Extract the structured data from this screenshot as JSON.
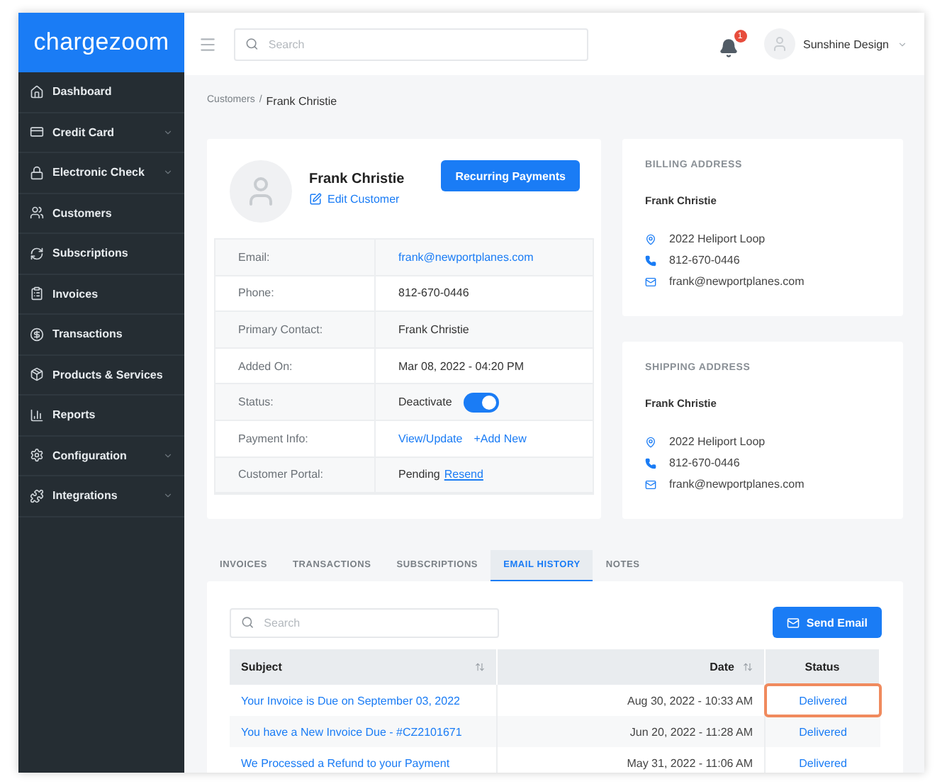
{
  "brand": {
    "logo": "chargezoom"
  },
  "sidebar": {
    "items": [
      {
        "label": "Dashboard",
        "expandable": false
      },
      {
        "label": "Credit Card",
        "expandable": true
      },
      {
        "label": "Electronic Check",
        "expandable": true
      },
      {
        "label": "Customers",
        "expandable": false
      },
      {
        "label": "Subscriptions",
        "expandable": false
      },
      {
        "label": "Invoices",
        "expandable": false
      },
      {
        "label": "Transactions",
        "expandable": false
      },
      {
        "label": "Products & Services",
        "expandable": false
      },
      {
        "label": "Reports",
        "expandable": false
      },
      {
        "label": "Configuration",
        "expandable": true
      },
      {
        "label": "Integrations",
        "expandable": true
      }
    ]
  },
  "topbar": {
    "search": {
      "placeholder": "Search"
    },
    "notifications": {
      "count": "1"
    },
    "user": {
      "name": "Sunshine Design"
    }
  },
  "breadcrumb": {
    "parent": "Customers",
    "separator": "/",
    "current": "Frank Christie"
  },
  "customer": {
    "name": "Frank Christie",
    "edit_link": "Edit Customer",
    "action_button": "Recurring Payments",
    "details": [
      {
        "kind": "text",
        "label": "Email:",
        "value": "frank@newportplanes.com",
        "link": true
      },
      {
        "kind": "text",
        "label": "Phone:",
        "value": "812-670-0446",
        "link": false
      },
      {
        "kind": "text",
        "label": "Primary Contact:",
        "value": "Frank Christie",
        "link": false
      },
      {
        "kind": "text",
        "label": "Added On:",
        "value": "Mar 08, 2022 - 04:20 PM",
        "link": false
      },
      {
        "kind": "toggle",
        "label": "Status:",
        "value": "Deactivate",
        "on": true
      },
      {
        "kind": "links",
        "label": "Payment Info:",
        "links": [
          "View/Update",
          "+Add New"
        ]
      },
      {
        "kind": "pending",
        "label": "Customer Portal:",
        "value": "Pending",
        "link_text": "Resend"
      }
    ]
  },
  "addresses": [
    {
      "title": "BILLING ADDRESS",
      "name": "Frank Christie",
      "street": "2022 Heliport Loop",
      "phone": "812-670-0446",
      "email": "frank@newportplanes.com"
    },
    {
      "title": "SHIPPING ADDRESS",
      "name": "Frank Christie",
      "street": "2022 Heliport Loop",
      "phone": "812-670-0446",
      "email": "frank@newportplanes.com"
    }
  ],
  "tabs": [
    {
      "label": "INVOICES",
      "selected": false
    },
    {
      "label": "TRANSACTIONS",
      "selected": false
    },
    {
      "label": "SUBSCRIPTIONS",
      "selected": false
    },
    {
      "label": "EMAIL HISTORY",
      "selected": true
    },
    {
      "label": "NOTES",
      "selected": false
    }
  ],
  "email_history": {
    "search": {
      "placeholder": "Search"
    },
    "send_button": "Send Email",
    "columns": [
      "Subject",
      "Date",
      "Status"
    ],
    "rows": [
      {
        "subject": "Your Invoice is Due on September 03, 2022",
        "date": "Aug 30, 2022 - 10:33 AM",
        "status": "Delivered",
        "highlighted": true
      },
      {
        "subject": "You have a New Invoice Due - #CZ2101671",
        "date": "Jun 20, 2022 - 11:28 AM",
        "status": "Delivered",
        "highlighted": false
      },
      {
        "subject": "We Processed a Refund to your Payment",
        "date": "May 31, 2022 - 11:06 AM",
        "status": "Delivered",
        "highlighted": false
      }
    ]
  }
}
